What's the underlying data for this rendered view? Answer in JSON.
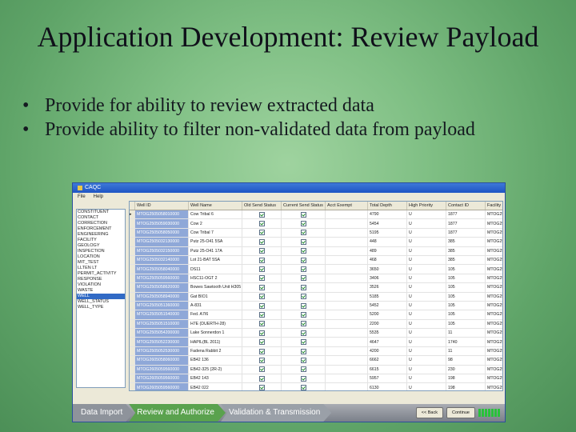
{
  "slide": {
    "title": "Application Development: Review Payload",
    "bullets": [
      "Provide for ability to review extracted data",
      "Provide ability to filter non-validated data from payload"
    ]
  },
  "window": {
    "title": "CAQC",
    "menu": [
      "File",
      "Help"
    ]
  },
  "left_list": {
    "items": [
      "CONSTITUENT",
      "CONTACT",
      "CORRECTION",
      "ENFORCEMENT",
      "ENGINEERING",
      "FACILITY",
      "GEOLOGY",
      "INSPECTION",
      "LOCATION",
      "MIT_TEST",
      "LLTEN LT",
      "PERMIT_ACTIVITY",
      "RESPONSE",
      "VIOLATION",
      "WASTE",
      "WELL",
      "WELL_STATUS",
      "WELL_TYPE"
    ],
    "selected": "WELL"
  },
  "grid": {
    "columns": [
      "Well ID",
      "Well Name",
      "Old Send Status",
      "Current Send Status",
      "Acct Exempt",
      "Total Depth",
      "High Priority",
      "Contact ID",
      "Facility ID"
    ],
    "rows": [
      [
        "MTOG2505058010000",
        "Cow Tribal 6",
        "",
        "",
        "",
        "4790",
        "U",
        "1877",
        "MTOG250050005"
      ],
      [
        "MTOG2505059030000",
        "Cow 2",
        "",
        "",
        "",
        "5454",
        "U",
        "1877",
        "MTOG25005007"
      ],
      [
        "MTOG2505058050000",
        "Cow Tribal 7",
        "",
        "",
        "",
        "5195",
        "U",
        "1877",
        "MTOG25005007"
      ],
      [
        "MTOG2505032130000",
        "Putz 25-O41 5SA",
        "",
        "",
        "",
        "448",
        "U",
        "385",
        "MTOG25002221"
      ],
      [
        "MTOG2505032150000",
        "Putz 25-O41 17A",
        "",
        "",
        "",
        "489",
        "U",
        "385",
        "MTOG25002221"
      ],
      [
        "MTOG2505032140000",
        "Lot 21-BAT 5SA",
        "",
        "",
        "",
        "468",
        "U",
        "385",
        "MTOG25002221"
      ],
      [
        "MTOG2505058040000",
        "DS11",
        "",
        "",
        "",
        "3650",
        "U",
        "105",
        "MTOG25005005"
      ],
      [
        "MTOG2505059560000",
        "HSC11-OGT 2",
        "",
        "",
        "",
        "3406",
        "U",
        "105",
        "MTOG25005005"
      ],
      [
        "MTOG2505058620000",
        "Bowes Sawtooth Unit H305",
        "",
        "",
        "",
        "3526",
        "U",
        "105",
        "MTOG25005005"
      ],
      [
        "MTOG2505058940000",
        "Gat BIO1",
        "",
        "",
        "",
        "5185",
        "U",
        "105",
        "MTOG25005005"
      ],
      [
        "MTOG2505051360000",
        "A-831",
        "",
        "",
        "",
        "5452",
        "U",
        "105",
        "MTOG25005005"
      ],
      [
        "MTOG2505051540000",
        "Fed. A7I6",
        "",
        "",
        "",
        "5200",
        "U",
        "105",
        "MTOG25005005"
      ],
      [
        "MTOG2505051510000",
        "H7E (DUERTH-28)",
        "",
        "",
        "",
        "2200",
        "U",
        "105",
        "MTOG25005005"
      ],
      [
        "MTOG2505054200000",
        "Lake Sonnerdon 1",
        "",
        "",
        "",
        "5535",
        "U",
        "11",
        "MTOG25002214"
      ],
      [
        "MTOG2505052230000",
        "HAPIL(BL 2011)",
        "",
        "",
        "",
        "4647",
        "U",
        "1740",
        "MTOG25002214"
      ],
      [
        "MTOG2505052530000",
        "Fadena Rabbit 2",
        "",
        "",
        "",
        "4200",
        "U",
        "11",
        "MTOG25002251"
      ],
      [
        "MTOG2605058060000",
        "EB42 136",
        "",
        "",
        "",
        "6662",
        "U",
        "98",
        "MTOG25005005"
      ],
      [
        "MTOG2605059560000",
        "EB42-325 (2R-2)",
        "",
        "",
        "",
        "6615",
        "U",
        "230",
        "MTOG25005005"
      ],
      [
        "MTOG2605059560000",
        "EB42 143",
        "",
        "",
        "",
        "5957",
        "U",
        "198",
        "MTOG25005005"
      ],
      [
        "MTOG2605059560000",
        "EB42 022",
        "",
        "",
        "",
        "6130",
        "U",
        "198",
        "MTOG25005005"
      ],
      [
        "MTOG2605059560000",
        "EB42 183",
        "",
        "",
        "",
        "5957",
        "U",
        "198",
        "MTOG25005005"
      ],
      [
        "MTOG2605059560000",
        "EB42 197",
        "",
        "",
        "",
        "5957",
        "U",
        "198",
        "MTOG25005005"
      ]
    ]
  },
  "workflow": {
    "steps": [
      "Data Import",
      "Review and Authorize",
      "Validation & Transmission"
    ],
    "active_step": "Review and Authorize",
    "back_label": "<< Back",
    "continue_label": "Continue"
  },
  "colors": {
    "active_step": "#5aa24e",
    "inactive_step": "#8e939b",
    "selection": "#316ac5"
  }
}
